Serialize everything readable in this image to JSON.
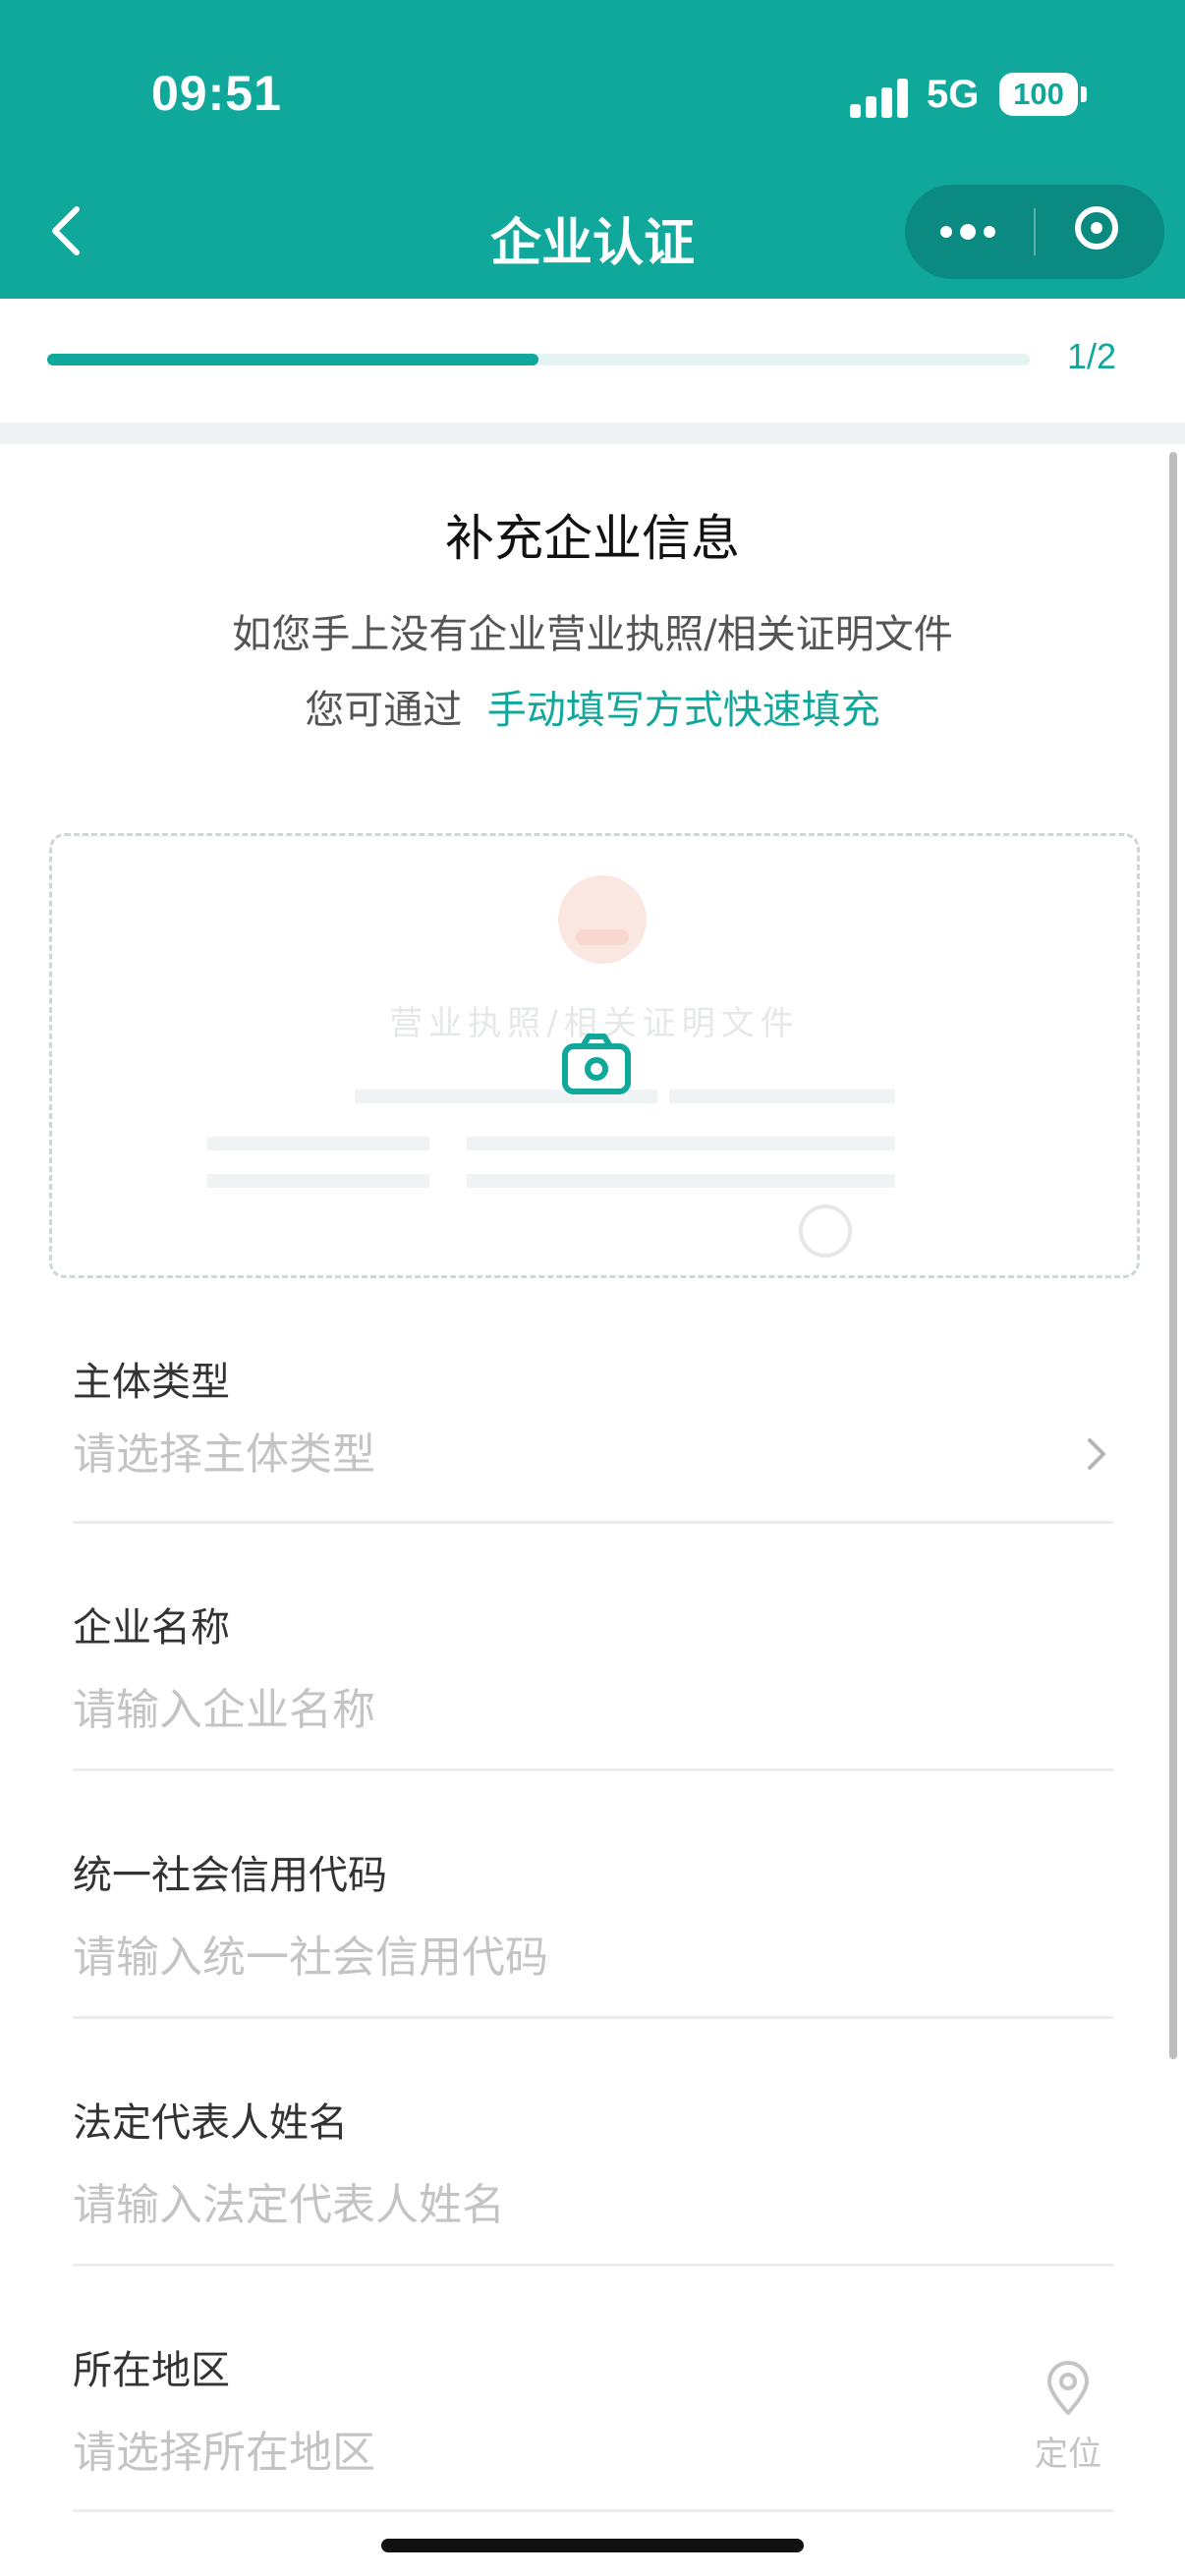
{
  "status_bar": {
    "time": "09:51",
    "network": "5G",
    "battery": "100"
  },
  "nav": {
    "title": "企业认证"
  },
  "progress": {
    "fraction": 0.5,
    "label": "1/2"
  },
  "intro": {
    "title": "补充企业信息",
    "line1": "如您手上没有企业营业执照/相关证明文件",
    "line2_prefix": "您可通过",
    "line2_link": "手动填写方式快速填充"
  },
  "upload": {
    "caption": "营业执照/相关证明文件"
  },
  "fields": [
    {
      "label": "主体类型",
      "placeholder": "请选择主体类型"
    },
    {
      "label": "企业名称",
      "placeholder": "请输入企业名称"
    },
    {
      "label": "统一社会信用代码",
      "placeholder": "请输入统一社会信用代码"
    },
    {
      "label": "法定代表人姓名",
      "placeholder": "请输入法定代表人姓名"
    },
    {
      "label": "所在地区",
      "placeholder": "请选择所在地区",
      "action_label": "定位"
    }
  ],
  "colors": {
    "brand": "#0fa89b",
    "placeholder": "#c4c4c4"
  }
}
